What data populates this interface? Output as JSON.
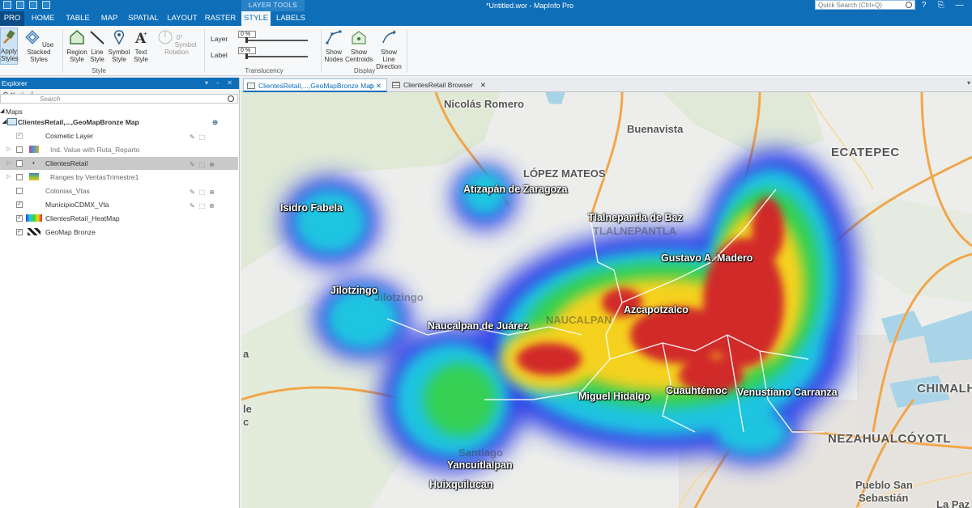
{
  "window": {
    "title": "*Untitled.wor - MapInfo Pro",
    "context_tab_group": "LAYER TOOLS",
    "quick_search_placeholder": "Quick Search (Ctrl+Q)",
    "buttons": [
      "?",
      "⎘",
      "—"
    ]
  },
  "tabs": [
    "PRO",
    "HOME",
    "TABLE",
    "MAP",
    "SPATIAL",
    "LAYOUT",
    "RASTER",
    "STYLE",
    "LABELS"
  ],
  "active_tab": "STYLE",
  "ribbon": {
    "apply_styles": "Apply Styles",
    "use_stacked_styles": "Use Stacked Styles",
    "region_style": "Region Style",
    "line_style": "Line Style",
    "symbol_style": "Symbol Style",
    "text_style": "Text Style",
    "symbol_rotation": "Symbol Rotation",
    "rotation_value": "0°",
    "style_group": "Style",
    "layer_label": "Layer",
    "label_label": "Label",
    "layer_translucency": "0 %",
    "label_translucency": "0 %",
    "translucency_group": "Translucency",
    "show_nodes": "Show Nodes",
    "show_centroids": "Show Centroids",
    "show_line_direction": "Show Line Direction",
    "display_group": "Display"
  },
  "explorer": {
    "title": "Explorer",
    "search_placeholder": "Search",
    "maps_header": "Maps",
    "map_name": "ClientesRetail,...,GeoMapBronze Map",
    "layers": [
      {
        "name": "Cosmetic Layer",
        "checked": true
      },
      {
        "name": "Ind. Value with Ruta_Reparto",
        "checked": false
      },
      {
        "name": "ClientesRetail",
        "checked": false,
        "selected": true
      },
      {
        "name": "Ranges by VentasTrimestre1",
        "checked": false
      },
      {
        "name": "Colonias_Vtas",
        "checked": false
      },
      {
        "name": "MunicipioCDMX_Vta",
        "checked": true
      },
      {
        "name": "ClientesRetail_HeatMap",
        "checked": true
      },
      {
        "name": "GeoMap Bronze",
        "checked": true
      }
    ]
  },
  "doc_tabs": [
    {
      "label": "ClientesRetail,...,GeoMapBronze Map",
      "active": true
    },
    {
      "label": "ClientesRetail Browser",
      "active": false
    }
  ],
  "map_labels": {
    "nicolas_romero": "Nicolás Romero",
    "buenavista": "Buenavista",
    "ecatepec": "ECATEPEC",
    "lopez_mateos": "LÓPEZ MATEOS",
    "atizapan": "Atizapán de Zaragoza",
    "isidro_fabela": "Isidro Fabela",
    "tlalnepantla": "Tlalnepantla de Baz",
    "tlalnepantla_area": "TLALNEPANTLA",
    "gustavo_madero": "Gustavo A. Madero",
    "jilotzingo": "Jilotzingo",
    "jilotzingo_ghost": "Jilotzingo",
    "azcapotzalco": "Azcapotzalco",
    "naucalpan_juarez": "Naucalpan de Juárez",
    "naucalpan_area": "NAUCALPAN",
    "cuauhtemoc": "Cuauhtémoc",
    "venustiano_carranza": "Venustiano Carranza",
    "miguel_hidalgo": "Miguel Hidalgo",
    "chimalhuacan": "CHIMALH",
    "nezahualcoyotl": "NEZAHUALCÓYOTL",
    "santiago": "Santiago",
    "yancuitlalpan": "Yancuitlalpan",
    "huixquilucan": "Huixquilucan",
    "pueblo_san": "Pueblo San",
    "sebastian": "Sebastián",
    "la_paz": "La Paz",
    "left_a": "a",
    "left_le": "le",
    "left_c": "c"
  },
  "colors": {
    "brand_blue": "#0e6eb8",
    "heat_low": "#2a3ee8",
    "heat_mid": "#ffd21a",
    "heat_high": "#d0202a"
  }
}
